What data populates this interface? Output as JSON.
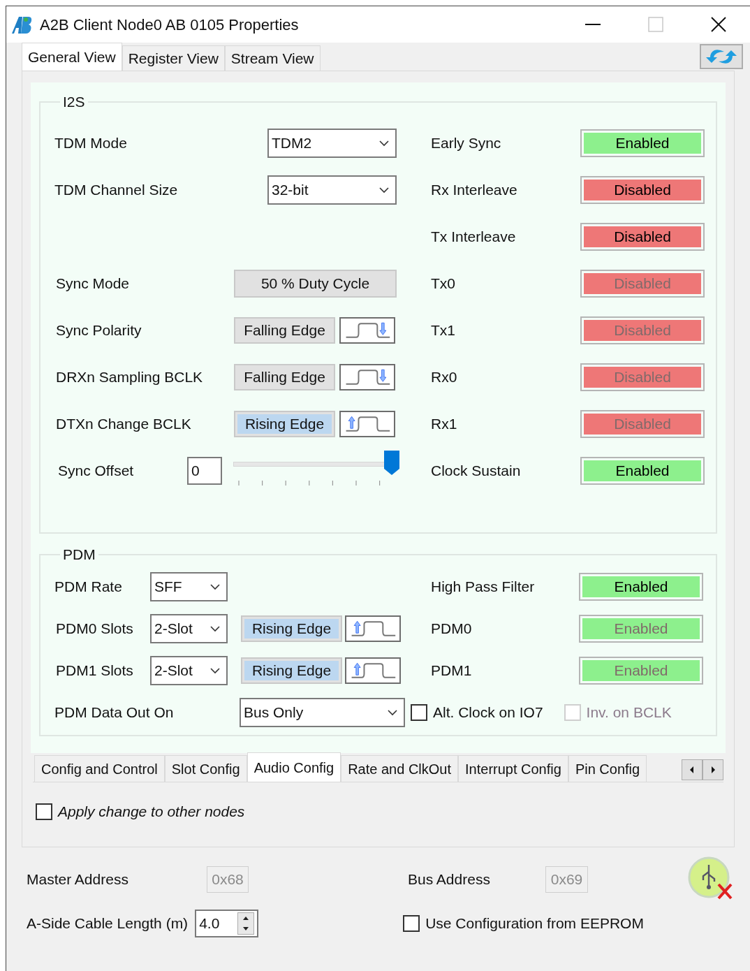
{
  "window": {
    "title": "A2B Client Node0 AB 0105 Properties"
  },
  "tabs": [
    {
      "label": "General View",
      "selected": true
    },
    {
      "label": "Register View",
      "selected": false
    },
    {
      "label": "Stream View",
      "selected": false
    }
  ],
  "i2s": {
    "legend": "I2S",
    "rows": [
      {
        "left": {
          "kind": "select",
          "label": "TDM Mode",
          "value": "TDM2"
        },
        "right": {
          "label": "Early Sync",
          "status": "Enabled",
          "on": true,
          "disabled": false
        }
      },
      {
        "left": {
          "kind": "select",
          "label": "TDM Channel Size",
          "value": "32-bit"
        },
        "right": {
          "label": "Rx Interleave",
          "status": "Disabled",
          "on": false,
          "disabled": false
        }
      },
      {
        "right": {
          "label": "Tx Interleave",
          "status": "Disabled",
          "on": false,
          "disabled": false
        }
      },
      {
        "left": {
          "kind": "button",
          "label": "Sync Mode",
          "value": "50 % Duty Cycle"
        },
        "right": {
          "label": "Tx0",
          "status": "Disabled",
          "on": false,
          "disabled": true
        }
      },
      {
        "left": {
          "kind": "edge",
          "label": "Sync Polarity",
          "value": "Falling Edge",
          "rising": false
        },
        "right": {
          "label": "Tx1",
          "status": "Disabled",
          "on": false,
          "disabled": true
        }
      },
      {
        "left": {
          "kind": "edge",
          "label": "DRXn Sampling BCLK",
          "value": "Falling Edge",
          "rising": false
        },
        "right": {
          "label": "Rx0",
          "status": "Disabled",
          "on": false,
          "disabled": true
        }
      },
      {
        "left": {
          "kind": "edge",
          "label": "DTXn Change BCLK",
          "value": "Rising Edge",
          "rising": true
        },
        "right": {
          "label": "Rx1",
          "status": "Disabled",
          "on": false,
          "disabled": true
        }
      },
      {
        "left": {
          "kind": "slider",
          "label": "Sync Offset",
          "value": "0",
          "level": 1
        },
        "right": {
          "label": "Clock Sustain",
          "status": "Enabled",
          "on": true,
          "disabled": false
        }
      }
    ]
  },
  "pdm": {
    "legend": "PDM",
    "rows": [
      {
        "left": {
          "kind": "select",
          "label": "PDM Rate",
          "value": "SFF"
        },
        "right": {
          "label": "High Pass Filter",
          "status": "Enabled",
          "on": true,
          "disabled": false
        }
      },
      {
        "left": {
          "kind": "select_edge",
          "label": "PDM0 Slots",
          "value": "2-Slot",
          "edge_label": "Rising Edge",
          "rising": true
        },
        "right": {
          "label": "PDM0",
          "status": "Enabled",
          "on": true,
          "disabled": true
        }
      },
      {
        "left": {
          "kind": "select_edge",
          "label": "PDM1 Slots",
          "value": "2-Slot",
          "edge_label": "Rising Edge",
          "rising": true
        },
        "right": {
          "label": "PDM1",
          "status": "Enabled",
          "on": true,
          "disabled": true
        }
      },
      {
        "left": {
          "kind": "wide_select",
          "label": "PDM Data Out On",
          "value": "Bus Only"
        },
        "checks": [
          {
            "label": "Alt. Clock on IO7",
            "checked": false,
            "disabled": false
          },
          {
            "label": "Inv. on BCLK",
            "checked": false,
            "disabled": true
          }
        ]
      }
    ]
  },
  "sub_tabs": [
    {
      "label": "Config and Control",
      "selected": false
    },
    {
      "label": "Slot Config",
      "selected": false
    },
    {
      "label": "Audio Config",
      "selected": true
    },
    {
      "label": "Rate and ClkOut",
      "selected": false
    },
    {
      "label": "Interrupt Config",
      "selected": false
    },
    {
      "label": "Pin Config",
      "selected": false
    }
  ],
  "apply_change": {
    "label": "Apply change to other nodes",
    "checked": false
  },
  "footer": {
    "master_address": {
      "label": "Master Address",
      "value": "0x68",
      "disabled": true
    },
    "bus_address": {
      "label": "Bus Address",
      "value": "0x69",
      "disabled": true
    },
    "cable_length": {
      "label": "A-Side Cable Length (m)",
      "value": "4.0"
    },
    "eeprom": {
      "label": "Use Configuration from EEPROM",
      "checked": false
    }
  }
}
